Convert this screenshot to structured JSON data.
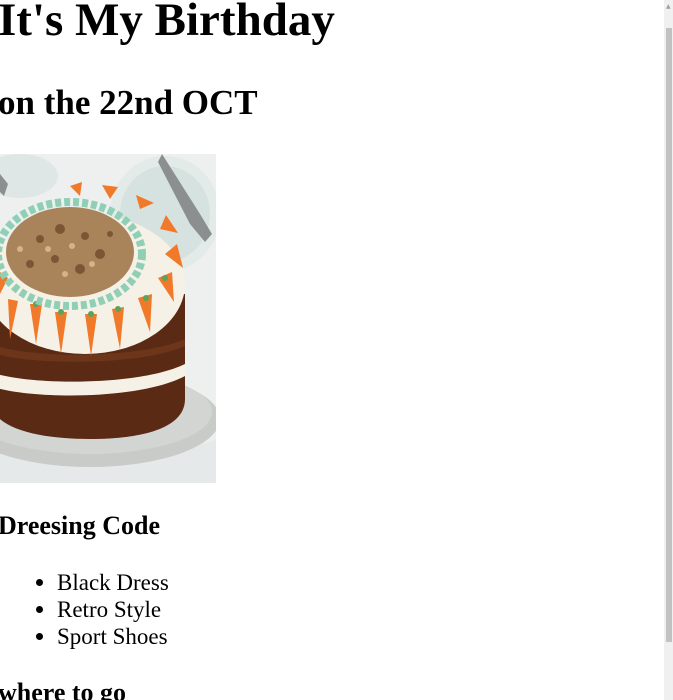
{
  "page": {
    "title": "It's My Birthday",
    "subtitle": "on the 22nd OCT"
  },
  "image": {
    "name": "carrot-cake-image",
    "colors": {
      "background": "#eef0ef",
      "plate": "#c9cbc9",
      "sponge": "#5a2a14",
      "frosting": "#f6f1e6",
      "carrot": "#f07a2a",
      "walnut": "#a9845a",
      "mint_rim": "#8fcfb6"
    }
  },
  "dressing": {
    "title": "Dreesing Code",
    "items": [
      {
        "label": "Black Dress"
      },
      {
        "label": "Retro Style"
      },
      {
        "label": "Sport Shoes"
      }
    ]
  },
  "where": {
    "title": "where to go"
  },
  "scrollbar": {
    "arrow_icon": "scroll-up-arrow-icon"
  }
}
